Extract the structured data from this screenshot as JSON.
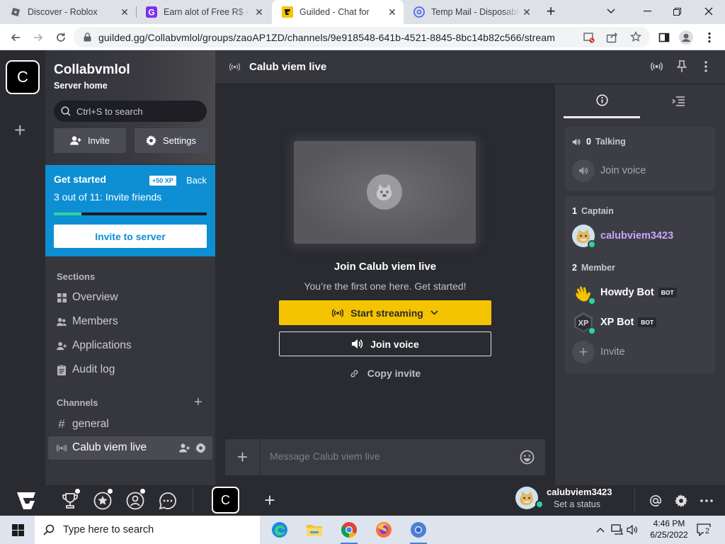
{
  "browser": {
    "tabs": [
      {
        "title": "Discover - Roblox",
        "icon": "roblox-icon",
        "active": false
      },
      {
        "title": "Earn alot of Free R$ - G",
        "icon": "guilded-g-icon",
        "active": false
      },
      {
        "title": "Guilded - Chat for",
        "icon": "guilded-icon",
        "active": true
      },
      {
        "title": "Temp Mail - Disposable",
        "icon": "at-sign-icon",
        "active": false
      }
    ],
    "new_tab_label": "+",
    "url": "guilded.gg/Collabvmlol/groups/zaoAP1ZD/channels/9e918548-641b-4521-8845-8bc14b82c566/stream"
  },
  "rail": {
    "server_initial": "C",
    "add_label": "+"
  },
  "sidebar": {
    "server_name": "Collabvmlol",
    "server_home": "Server home",
    "search_placeholder": "Ctrl+S to search",
    "invite_label": "Invite",
    "settings_label": "Settings",
    "get_started": {
      "title": "Get started",
      "xp_badge": "+50 XP",
      "back_label": "Back",
      "progress_text": "3 out of 11: Invite friends",
      "progress_fraction": 0.18,
      "button_label": "Invite to server"
    },
    "sections_header": "Sections",
    "sections": [
      {
        "label": "Overview",
        "icon": "grid-icon"
      },
      {
        "label": "Members",
        "icon": "members-icon"
      },
      {
        "label": "Applications",
        "icon": "user-add-icon"
      },
      {
        "label": "Audit log",
        "icon": "clipboard-icon"
      }
    ],
    "channels_header": "Channels",
    "channels": [
      {
        "label": "general",
        "icon": "hash-icon"
      },
      {
        "label": "Calub viem live",
        "icon": "stream-icon",
        "active": true
      }
    ]
  },
  "main": {
    "channel_title": "Calub viem live",
    "join_title": "Join Calub viem live",
    "join_subtitle": "You’re the first one here. Get started!",
    "start_streaming_label": "Start streaming",
    "join_voice_label": "Join voice",
    "copy_invite_label": "Copy invite",
    "composer_placeholder": "Message Calub viem live"
  },
  "right": {
    "talking_count": "0",
    "talking_label": "Talking",
    "join_voice_label": "Join voice",
    "captain_count": "1",
    "captain_label": "Captain",
    "captain_name": "calubviem3423",
    "member_count": "2",
    "member_label": "Member",
    "members": [
      {
        "name": "Howdy Bot",
        "badge": "BOT"
      },
      {
        "name": "XP Bot",
        "badge": "BOT"
      }
    ],
    "invite_label": "Invite"
  },
  "bottombar": {
    "username": "calubviem3423",
    "status": "Set a status",
    "server_initial": "C",
    "add_label": "+"
  },
  "taskbar": {
    "search_placeholder": "Type here to search",
    "time": "4:46 PM",
    "date": "6/25/2022",
    "notification_count": "2"
  },
  "colors": {
    "accent_yellow": "#f5c400",
    "get_started_blue": "#0e8fd4",
    "online_green": "#2bd49b",
    "captain_purple": "#c8a5ff"
  }
}
